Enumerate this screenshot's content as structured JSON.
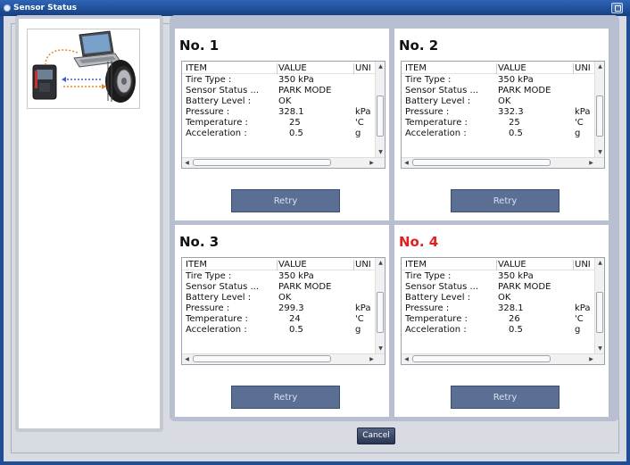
{
  "window": {
    "title": "Sensor Status"
  },
  "columns": {
    "item": "ITEM",
    "value": "VALUE",
    "unit": "UNI"
  },
  "panels": [
    {
      "title": "No. 1",
      "title_color": "#111111",
      "rows": [
        {
          "item": "Tire Type :",
          "value": "350 kPa",
          "unit": ""
        },
        {
          "item": "Sensor Status ...",
          "value": "PARK MODE",
          "unit": ""
        },
        {
          "item": "Battery Level :",
          "value": "OK",
          "unit": ""
        },
        {
          "item": "Pressure :",
          "value": "328.1",
          "unit": "kPa"
        },
        {
          "item": "Temperature :",
          "value": "25",
          "unit": "'C"
        },
        {
          "item": "Acceleration :",
          "value": "0.5",
          "unit": "g"
        }
      ],
      "retry_label": "Retry"
    },
    {
      "title": "No. 2",
      "title_color": "#111111",
      "rows": [
        {
          "item": "Tire Type :",
          "value": "350 kPa",
          "unit": ""
        },
        {
          "item": "Sensor Status ...",
          "value": "PARK MODE",
          "unit": ""
        },
        {
          "item": "Battery Level :",
          "value": "OK",
          "unit": ""
        },
        {
          "item": "Pressure :",
          "value": "332.3",
          "unit": "kPa"
        },
        {
          "item": "Temperature :",
          "value": "25",
          "unit": "'C"
        },
        {
          "item": "Acceleration :",
          "value": "0.5",
          "unit": "g"
        }
      ],
      "retry_label": "Retry"
    },
    {
      "title": "No. 3",
      "title_color": "#111111",
      "rows": [
        {
          "item": "Tire Type :",
          "value": "350 kPa",
          "unit": ""
        },
        {
          "item": "Sensor Status ...",
          "value": "PARK MODE",
          "unit": ""
        },
        {
          "item": "Battery Level :",
          "value": "OK",
          "unit": ""
        },
        {
          "item": "Pressure :",
          "value": "299.3",
          "unit": "kPa"
        },
        {
          "item": "Temperature :",
          "value": "24",
          "unit": "'C"
        },
        {
          "item": "Acceleration :",
          "value": "0.5",
          "unit": "g"
        }
      ],
      "retry_label": "Retry"
    },
    {
      "title": "No. 4",
      "title_color": "#e02020",
      "rows": [
        {
          "item": "Tire Type :",
          "value": "350 kPa",
          "unit": ""
        },
        {
          "item": "Sensor Status ...",
          "value": "PARK MODE",
          "unit": ""
        },
        {
          "item": "Battery Level :",
          "value": "OK",
          "unit": ""
        },
        {
          "item": "Pressure :",
          "value": "328.1",
          "unit": "kPa"
        },
        {
          "item": "Temperature :",
          "value": "26",
          "unit": "'C"
        },
        {
          "item": "Acceleration :",
          "value": "0.5",
          "unit": "g"
        }
      ],
      "retry_label": "Retry"
    }
  ],
  "footer": {
    "cancel_label": "Cancel"
  },
  "icons": {
    "title": "sensor-icon",
    "illustration": "tpms-tool-laptop-tire-icon"
  }
}
